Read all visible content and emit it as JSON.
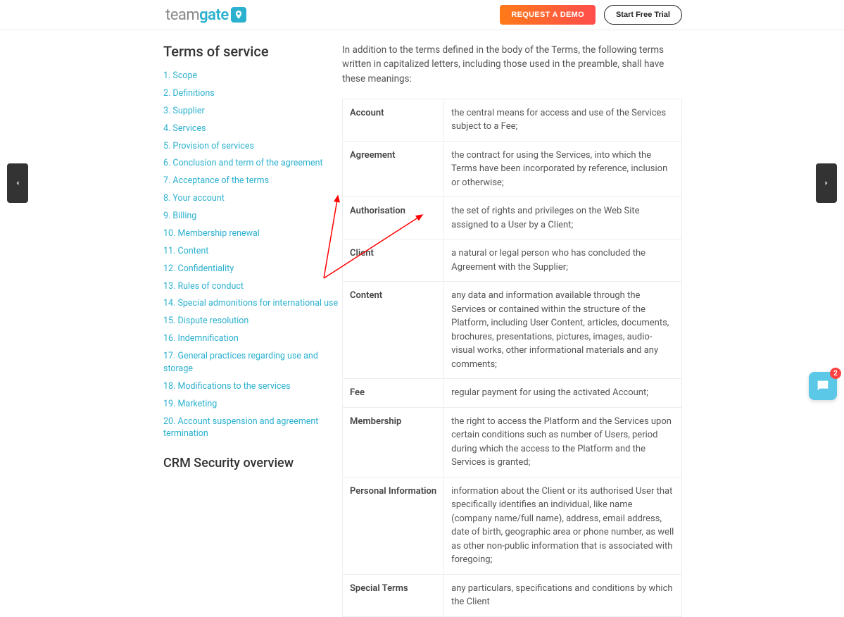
{
  "logo": {
    "part1": "team",
    "part2": "gate"
  },
  "buttons": {
    "demo": "REQUEST A DEMO",
    "trial": "Start Free Trial"
  },
  "sidebar": {
    "title": "Terms of service",
    "items": [
      "1. Scope",
      "2. Definitions",
      "3. Supplier",
      "4. Services",
      "5. Provision of services",
      "6. Conclusion and term of the agreement",
      "7. Acceptance of the terms",
      "8. Your account",
      "9. Billing",
      "10. Membership renewal",
      "11. Content",
      "12. Confidentiality",
      "13. Rules of conduct",
      "14. Special admonitions for international use",
      "15. Dispute resolution",
      "16. Indemnification",
      "17. General practices regarding use and storage",
      "18. Modifications to the services",
      "19. Marketing",
      "20. Account suspension and agreement termination"
    ],
    "heading2": "CRM Security overview"
  },
  "main": {
    "intro": "In addition to the terms defined in the body of the Terms, the following terms written in capitalized letters, including those used in the preamble, shall have these meanings:",
    "defs": [
      {
        "term": "Account",
        "def": "the central means for access and use of the Services subject to a Fee;"
      },
      {
        "term": "Agreement",
        "def": "the contract for using the Services, into which the Terms have been incorporated by reference, inclusion or otherwise;"
      },
      {
        "term": "Authorisation",
        "def": "the set of rights and privileges on the Web Site assigned to a User by a Client;"
      },
      {
        "term": "Client",
        "def": "a natural or legal person who has concluded the Agreement with the Supplier;"
      },
      {
        "term": "Content",
        "def": "any data and information available through the Services or contained within the structure of the Platform, including User Content, articles, documents, brochures, presentations, pictures, images, audio-visual works, other informational materials and any comments;"
      },
      {
        "term": "Fee",
        "def": "regular payment for using the activated Account;"
      },
      {
        "term": "Membership",
        "def": "the right to access the Platform and the Services upon certain conditions such as number of Users, period during which the access to the Platform and the Services is granted;"
      },
      {
        "term": "Personal Information",
        "def": "information about the Client or its authorised User that specifically identifies an individual, like name (company name/full name), address, email address, date of birth, geographic area or phone number, as well as other non-public information that is associated with foregoing;"
      },
      {
        "term": "Special Terms",
        "def": "any particulars, specifications and conditions by which the Client"
      }
    ]
  },
  "chat": {
    "badge": "2"
  }
}
